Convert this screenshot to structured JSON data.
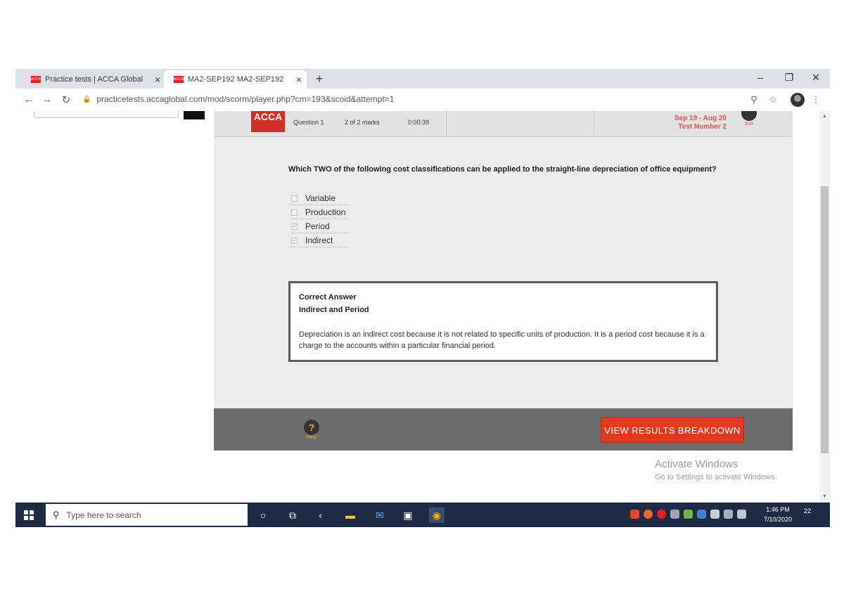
{
  "browser": {
    "tabs": [
      {
        "title": "Practice tests | ACCA Global",
        "favicon_text": "ACCA"
      },
      {
        "title": "MA2-SEP192 MA2-SEP192",
        "favicon_text": "ACCA"
      }
    ],
    "url": "practicetests.accaglobal.com/mod/scorm/player.php?cm=193&scoid&attempt=1"
  },
  "assessment": {
    "logo": "ACCA",
    "question_label": "Question 1",
    "marks": "2 of 2 marks",
    "timer": "0:00:39",
    "session_dates": "Sep 19 - Aug 20",
    "test_number": "Test Number 2",
    "exit_label": "Exit",
    "question_text": "Which TWO of the following cost classifications can be applied to the straight-line depreciation of office equipment?",
    "options": [
      {
        "label": "Variable",
        "checked": false
      },
      {
        "label": "Production",
        "checked": false
      },
      {
        "label": "Period",
        "checked": true
      },
      {
        "label": "Indirect",
        "checked": true
      }
    ],
    "answer": {
      "heading": "Correct Answer",
      "value": "Indirect and Period",
      "explanation": "Depreciation is an indirect cost because it is not related to specific units of production. It is a period cost because it is a charge to the accounts within a particular financial period."
    },
    "help_label": "Help",
    "results_button": "VIEW RESULTS BREAKDOWN"
  },
  "activation": {
    "title": "Activate Windows",
    "subtitle": "Go to Settings to activate Windows."
  },
  "taskbar": {
    "search_placeholder": "Type here to search",
    "time": "1:46 PM",
    "date": "7/10/2020",
    "notification_count": "22"
  },
  "colors": {
    "acca_red": "#d32d27",
    "button_red": "#e03a21",
    "footer_gray": "#6d6d6d",
    "taskbar": "#1f2a44"
  }
}
